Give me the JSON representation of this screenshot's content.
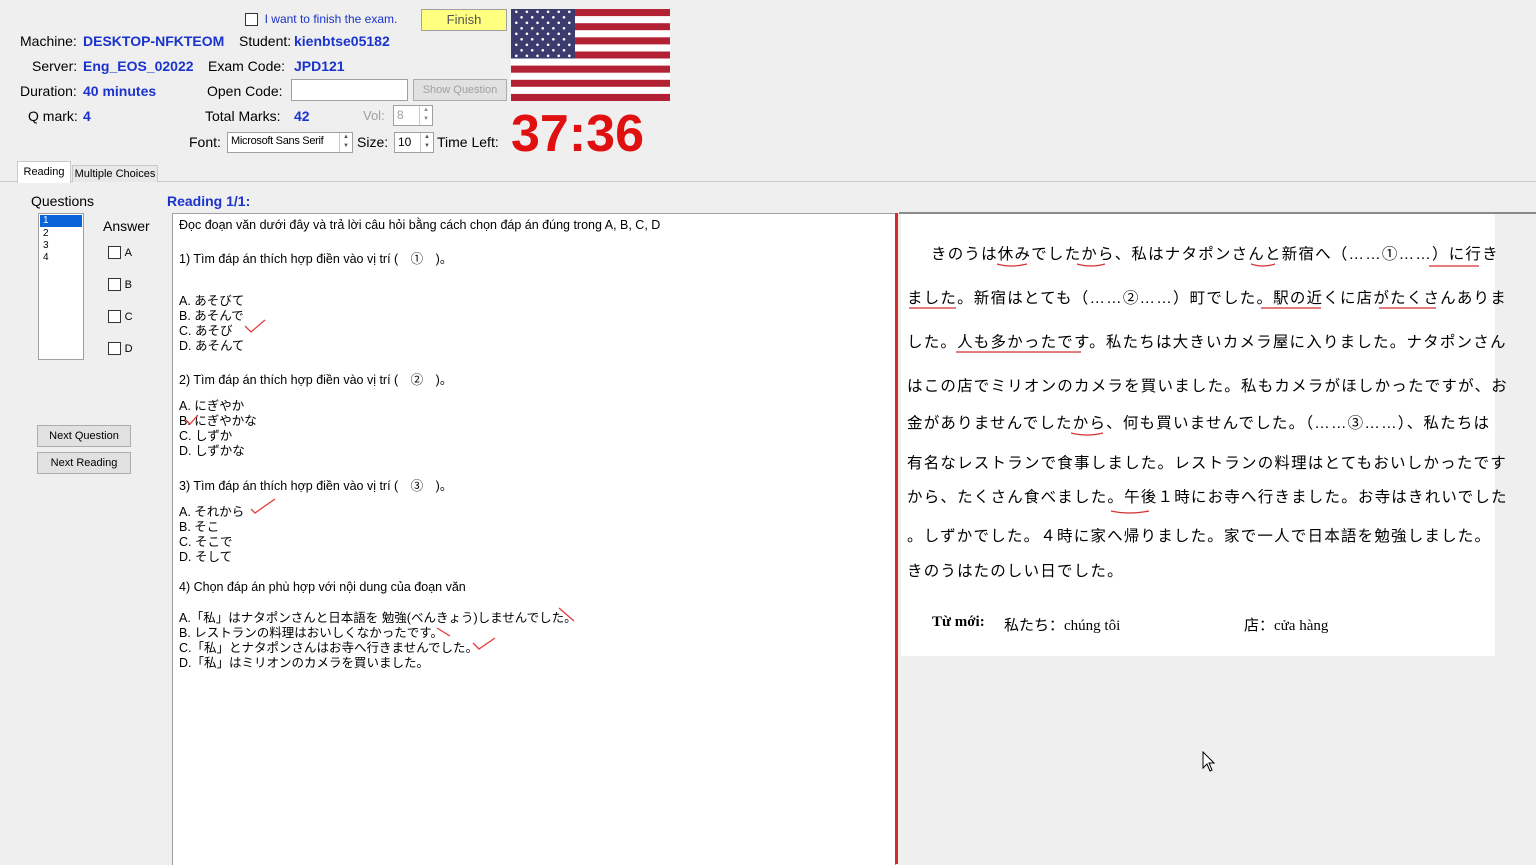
{
  "header": {
    "finish_checkbox_label": "I want to finish the exam.",
    "finish_button": "Finish",
    "machine_label": "Machine:",
    "machine_value": "DESKTOP-NFKTEOM",
    "student_label": "Student:",
    "student_value": "kienbtse05182",
    "server_label": "Server:",
    "server_value": "Eng_EOS_02022",
    "exam_code_label": "Exam Code:",
    "exam_code_value": "JPD121",
    "duration_label": "Duration:",
    "duration_value": "40 minutes",
    "open_code_label": "Open Code:",
    "open_code_value": "",
    "show_question_button": "Show Question",
    "q_mark_label": "Q mark:",
    "q_mark_value": "4",
    "total_marks_label": "Total Marks:",
    "total_marks_value": "42",
    "vol_label": "Vol:",
    "vol_value": "8",
    "font_label": "Font:",
    "font_value": "Microsoft Sans Serif",
    "size_label": "Size:",
    "size_value": "10",
    "time_left_label": "Time Left:",
    "time_left_value": "37:36"
  },
  "tabs": [
    "Reading",
    "Multiple Choices"
  ],
  "left_panel": {
    "questions_label": "Questions",
    "question_list": [
      "1",
      "2",
      "3",
      "4"
    ],
    "answer_label": "Answer",
    "answer_options": [
      "A",
      "B",
      "C",
      "D"
    ],
    "next_question_button": "Next Question",
    "next_reading_button": "Next Reading"
  },
  "reading_title": "Reading 1/1:",
  "questions_text": {
    "instruction": "Đọc đoạn văn dưới đây và trả lời câu hỏi bằng cách chọn đáp án đúng trong A, B, C, D",
    "q1": "1) Tìm đáp án thích hợp điền vào vị trí (　①　)。",
    "q1_a": "A. あそびて",
    "q1_b": "B. あそんで",
    "q1_c": "C. あそび",
    "q1_d": "D. あそんて",
    "q2": "2) Tìm đáp án thích hợp điền vào vị trí (　②　)。",
    "q2_a": "A. にぎやか",
    "q2_b": "B. にぎやかな",
    "q2_c": "C. しずか",
    "q2_d": "D. しずかな",
    "q3": "3) Tìm đáp án thích hợp điền vào vị trí (　③　)。",
    "q3_a": "A. それから",
    "q3_b": "B. そこ",
    "q3_c": "C. そこで",
    "q3_d": "D. そして",
    "q4": "4) Chọn đáp án phù hợp với nội dung của đoạn văn",
    "q4_a": "A.「私」はナタポンさんと日本語を 勉強(べんきょう)しませんでした。",
    "q4_b": "B. レストランの料理はおいしくなかったです。",
    "q4_c": "C.「私」とナタポンさんはお寺へ行きませんでした。",
    "q4_d": "D.「私」はミリオンのカメラを買いました。"
  },
  "passage": {
    "line1": "きのうは休みでしたから、私はナタポンさんと新宿へ（……①……）に行き",
    "line2": "ました。新宿はとても（……②……）町でした。駅の近くに店がたくさんありま",
    "line3": "した。人も多かったです。私たちは大きいカメラ屋に入りました。ナタポンさん",
    "line4": "はこの店でミリオンのカメラを買いました。私もカメラがほしかったですが、お",
    "line5": "金がありませんでしたから、何も買いませんでした。（……③……）、私たちは",
    "line6": "有名なレストランで食事しました。レストランの料理はとてもおいしかったです",
    "line7": "から、たくさん食べました。午後１時にお寺へ行きました。お寺はきれいでした",
    "line8": "。しずかでした。４時に家へ帰りました。家で一人で日本語を勉強しました。",
    "line9": "きのうはたのしい日でした。",
    "vocab_label": "Từ mới:",
    "vocab1": "私たち：chúng tôi",
    "vocab2": "店：cửa hàng"
  },
  "colors": {
    "accent_blue": "#1a33cc",
    "timer_red": "#e01010",
    "pen_red": "#e23b3b",
    "finish_yellow": "#ffff80"
  }
}
